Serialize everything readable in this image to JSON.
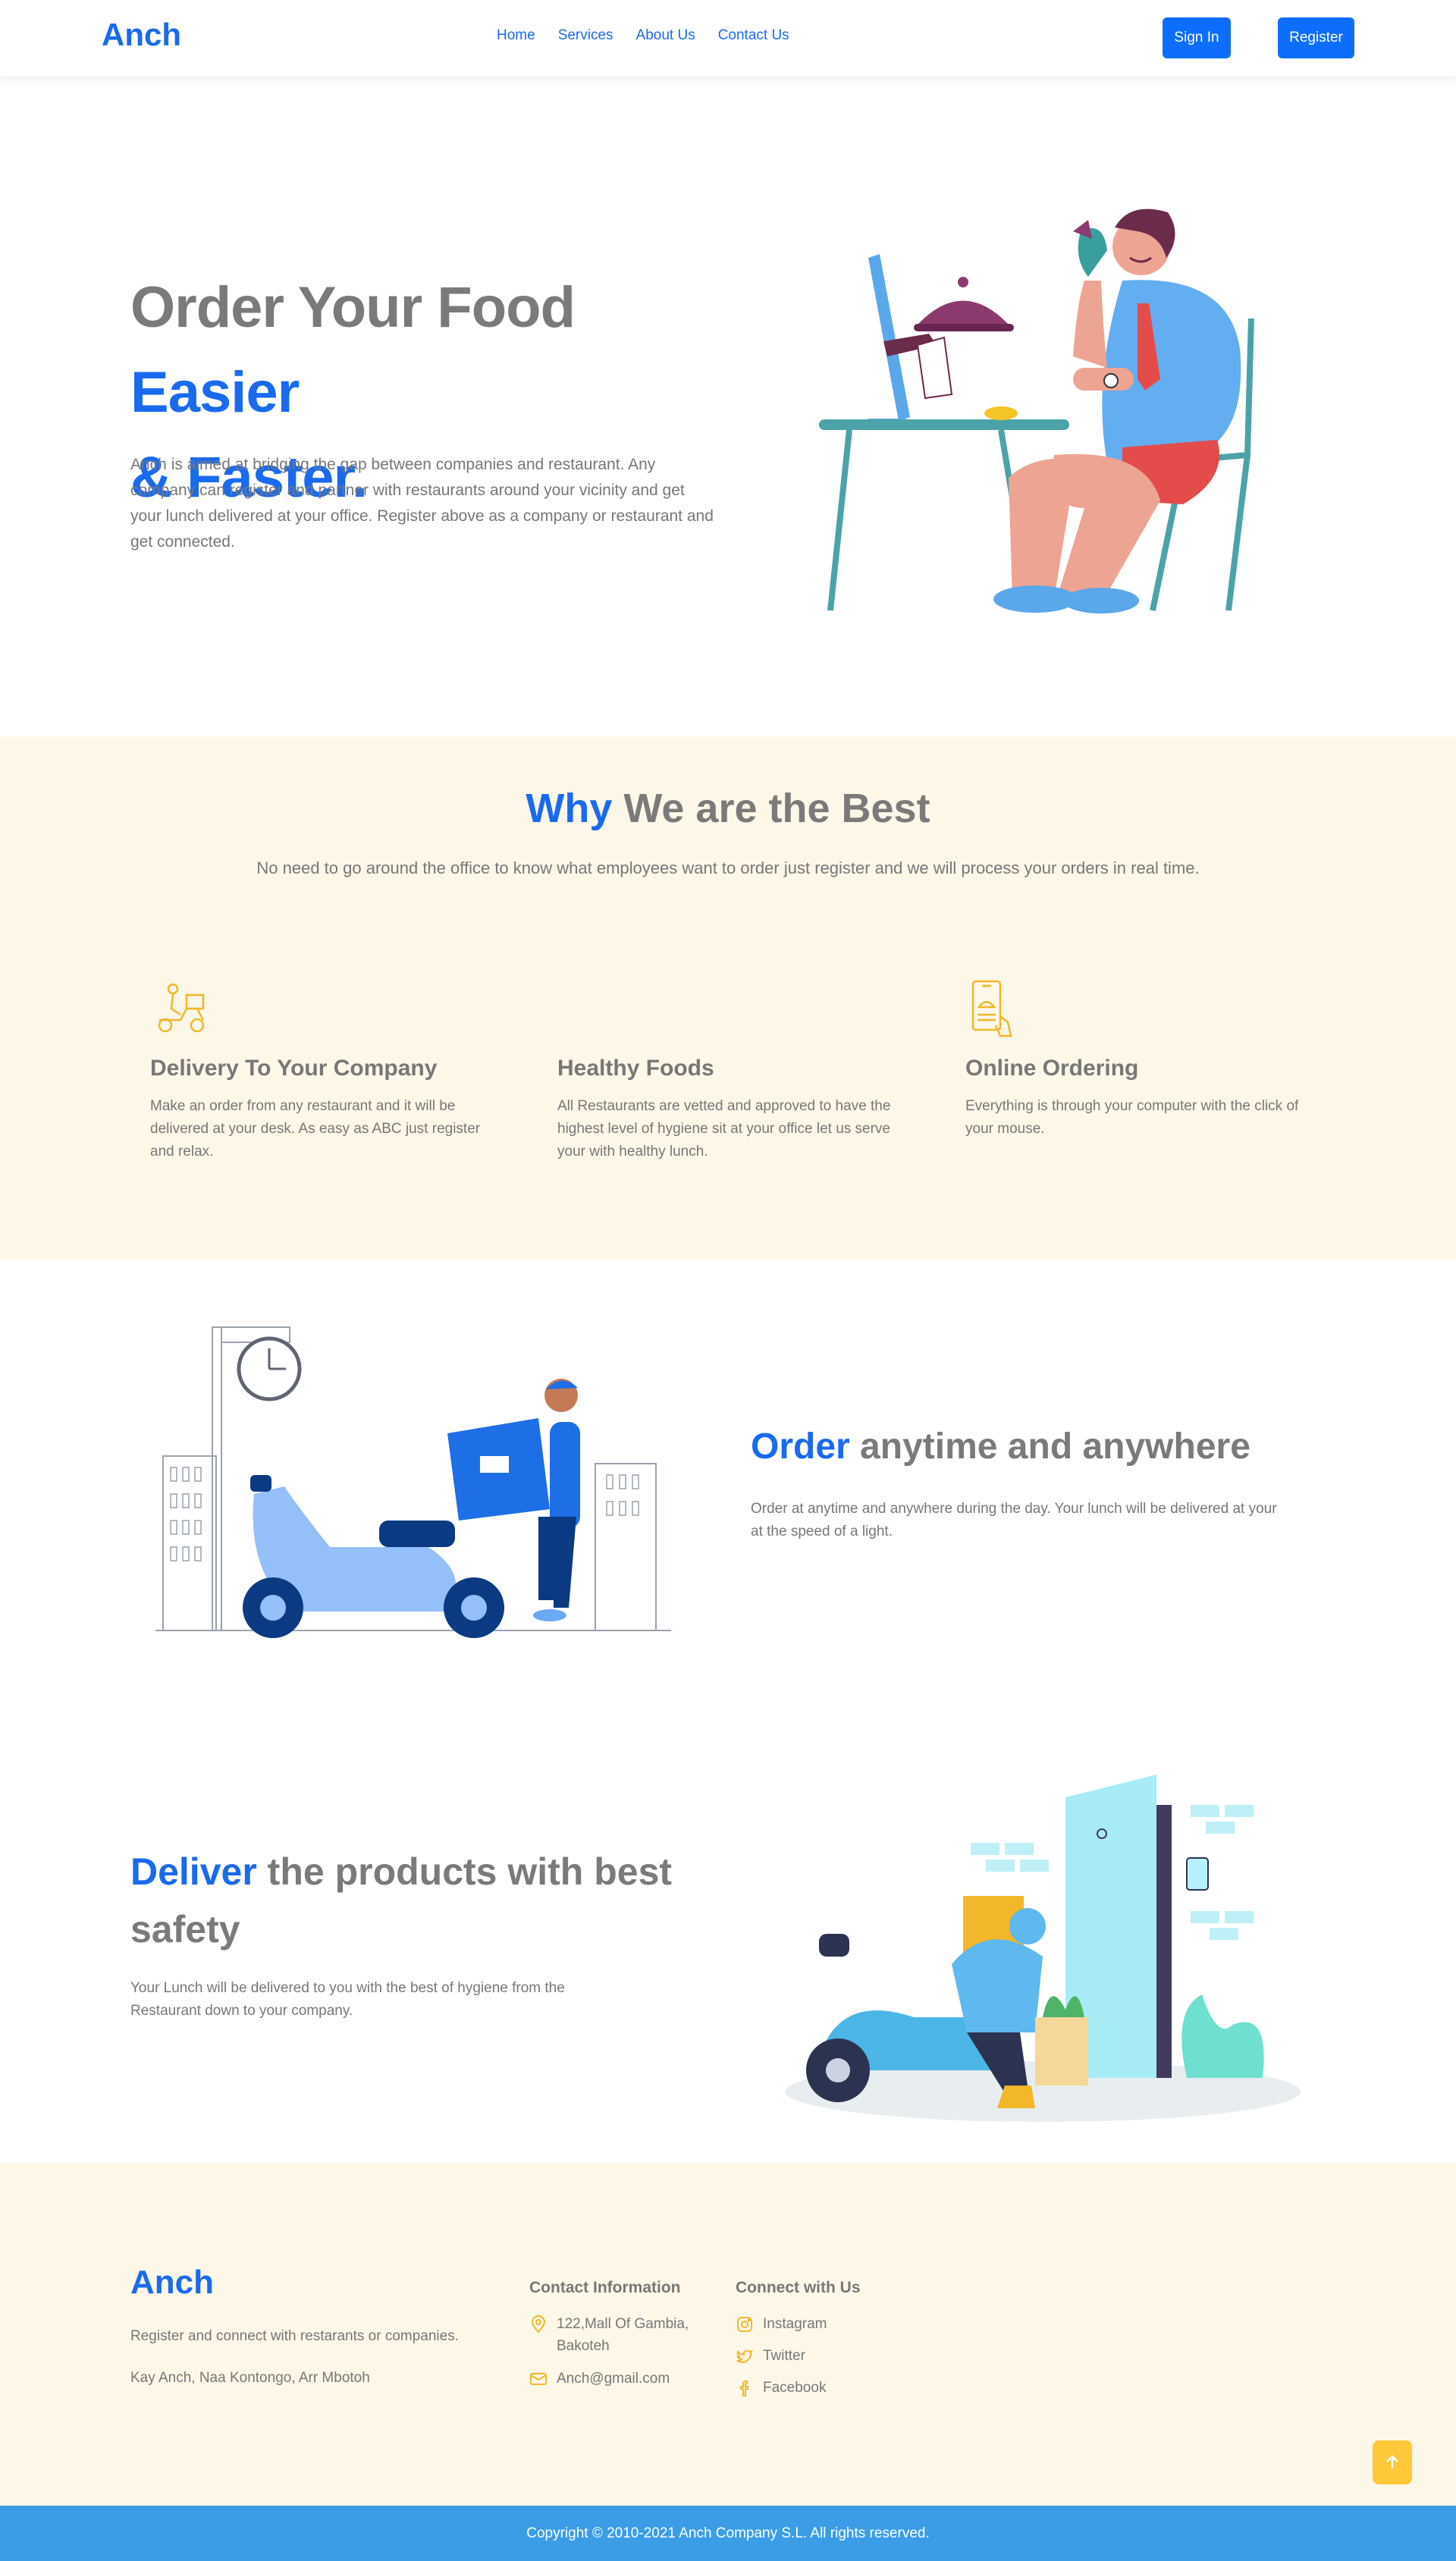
{
  "nav": {
    "brand": "Anch",
    "links": [
      "Home",
      "Services",
      "About Us",
      "Contact Us"
    ],
    "sign_in": "Sign In",
    "register": "Register"
  },
  "hero": {
    "title_plain": "Order Your Food ",
    "title_accent_1": "Easier",
    "title_accent_2": "& Faster.",
    "text": "Anch is aimed at bridging the gap between companies and restaurant. Any company can register and partner with restaurants around your vicinity and get your lunch delivered at your office. Register above as a company or restaurant and get connected."
  },
  "why": {
    "title_accent": "Why",
    "title_plain": " We are the Best",
    "subtitle": "No need to go around the office to know what employees want to order just register and we will process your orders in real time.",
    "features": [
      {
        "icon": "delivery-scooter-icon",
        "title": "Delivery To Your Company",
        "text": "Make an order from any restaurant and it will be delivered at your desk. As easy as ABC just register and relax."
      },
      {
        "icon": "healthy-food-icon",
        "title": "Healthy Foods",
        "text": "All Restaurants are vetted and approved to have the highest level of hygiene sit at your office let us serve your with healthy lunch."
      },
      {
        "icon": "mobile-order-icon",
        "title": "Online Ordering",
        "text": "Everything is through your computer with the click of your mouse."
      }
    ]
  },
  "order": {
    "title_accent": "Order",
    "title_plain": " anytime and anywhere",
    "text": "Order at anytime and anywhere during the day. Your lunch will be delivered at your at the speed of a light."
  },
  "deliver": {
    "title_accent": "Deliver",
    "title_plain": " the products with best safety",
    "text": "Your Lunch will be delivered to you with the best of hygiene from the Restaurant down to your company."
  },
  "footer": {
    "brand": "Anch",
    "tagline": "Register and connect with restarants or companies.",
    "address_line": "Kay Anch, Naa Kontongo, Arr Mbotoh",
    "contact_title": "Contact Information",
    "contact_location": "122,Mall Of Gambia, Bakoteh",
    "contact_email": "Anch@gmail.com",
    "social_title": "Connect with Us",
    "social": [
      "Instagram",
      "Twitter",
      "Facebook"
    ],
    "copyright": "Copyright © 2010-2021 Anch Company S.L. All rights reserved."
  },
  "colors": {
    "accent": "#1a6af0",
    "button": "#0d6efd",
    "section_bg": "#fdf7e8",
    "icon_yellow": "#f2b72a",
    "copyright_bar": "#3b9de6"
  }
}
